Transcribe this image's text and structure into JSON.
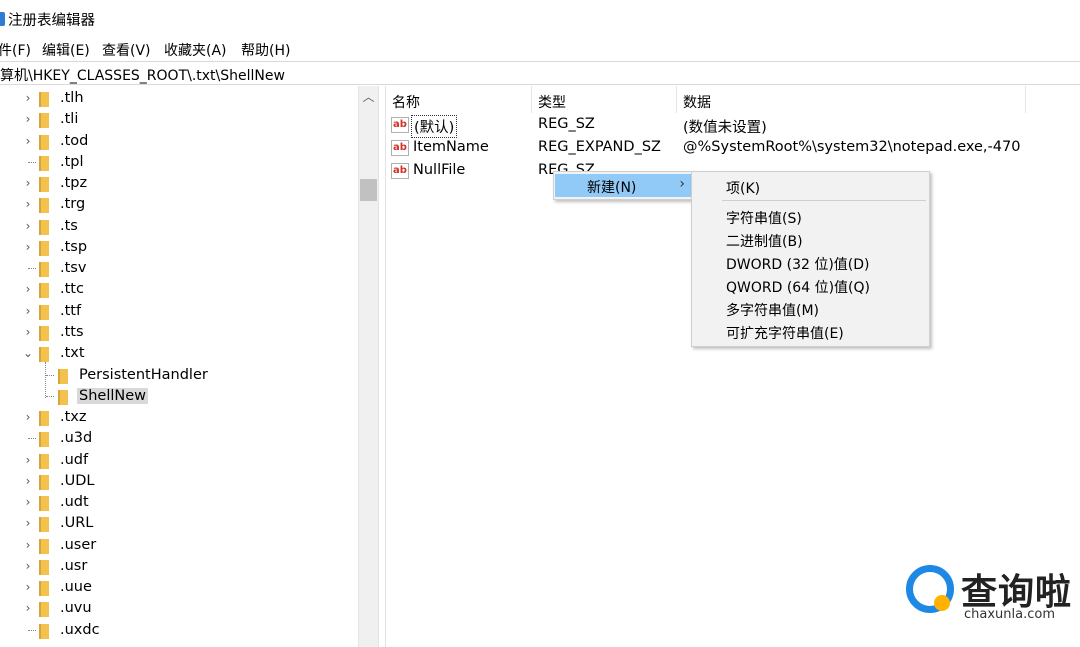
{
  "window": {
    "title": "注册表编辑器",
    "icon": "regedit-icon"
  },
  "menubar": [
    "件(F)",
    "编辑(E)",
    "查看(V)",
    "收藏夹(A)",
    "帮助(H)"
  ],
  "address": "算机\\HKEY_CLASSES_ROOT\\.txt\\ShellNew",
  "tree": {
    "items": [
      {
        "label": ".tlh",
        "expander": "collapsed"
      },
      {
        "label": ".tli",
        "expander": "collapsed"
      },
      {
        "label": ".tod",
        "expander": "collapsed"
      },
      {
        "label": ".tpl",
        "expander": "none"
      },
      {
        "label": ".tpz",
        "expander": "collapsed"
      },
      {
        "label": ".trg",
        "expander": "collapsed"
      },
      {
        "label": ".ts",
        "expander": "collapsed"
      },
      {
        "label": ".tsp",
        "expander": "collapsed"
      },
      {
        "label": ".tsv",
        "expander": "none"
      },
      {
        "label": ".ttc",
        "expander": "collapsed"
      },
      {
        "label": ".ttf",
        "expander": "collapsed"
      },
      {
        "label": ".tts",
        "expander": "collapsed"
      },
      {
        "label": ".txt",
        "expander": "expanded"
      },
      {
        "label": "PersistentHandler",
        "expander": "none"
      },
      {
        "label": "ShellNew",
        "expander": "none",
        "selected": true
      },
      {
        "label": ".txz",
        "expander": "collapsed"
      },
      {
        "label": ".u3d",
        "expander": "none"
      },
      {
        "label": ".udf",
        "expander": "collapsed"
      },
      {
        "label": ".UDL",
        "expander": "collapsed"
      },
      {
        "label": ".udt",
        "expander": "collapsed"
      },
      {
        "label": ".URL",
        "expander": "collapsed"
      },
      {
        "label": ".user",
        "expander": "collapsed"
      },
      {
        "label": ".usr",
        "expander": "collapsed"
      },
      {
        "label": ".uue",
        "expander": "collapsed"
      },
      {
        "label": ".uvu",
        "expander": "collapsed"
      },
      {
        "label": ".uxdc",
        "expander": "none"
      }
    ]
  },
  "columns": [
    "名称",
    "类型",
    "数据"
  ],
  "values": [
    {
      "name": "(默认)",
      "type": "REG_SZ",
      "data": "(数值未设置)",
      "icon": "string-value-icon"
    },
    {
      "name": "ItemName",
      "type": "REG_EXPAND_SZ",
      "data": "@%SystemRoot%\\system32\\notepad.exe,-470",
      "icon": "string-value-icon"
    },
    {
      "name": "NullFile",
      "type": "REG_SZ",
      "data": "",
      "icon": "string-value-icon"
    }
  ],
  "context_menu": {
    "item": "新建(N)",
    "arrow": "›"
  },
  "submenu": {
    "first": "项(K)",
    "items": [
      "字符串值(S)",
      "二进制值(B)",
      "DWORD (32 位)值(D)",
      "QWORD (64 位)值(Q)",
      "多字符串值(M)",
      "可扩充字符串值(E)"
    ]
  },
  "watermark": {
    "text": "查询啦",
    "sub": "chaxunla.com"
  },
  "colors": {
    "highlight": "#91c9f7",
    "folder": "#f2c14e",
    "watermark_blue": "#1e88e5",
    "watermark_orange": "#ffb300"
  }
}
